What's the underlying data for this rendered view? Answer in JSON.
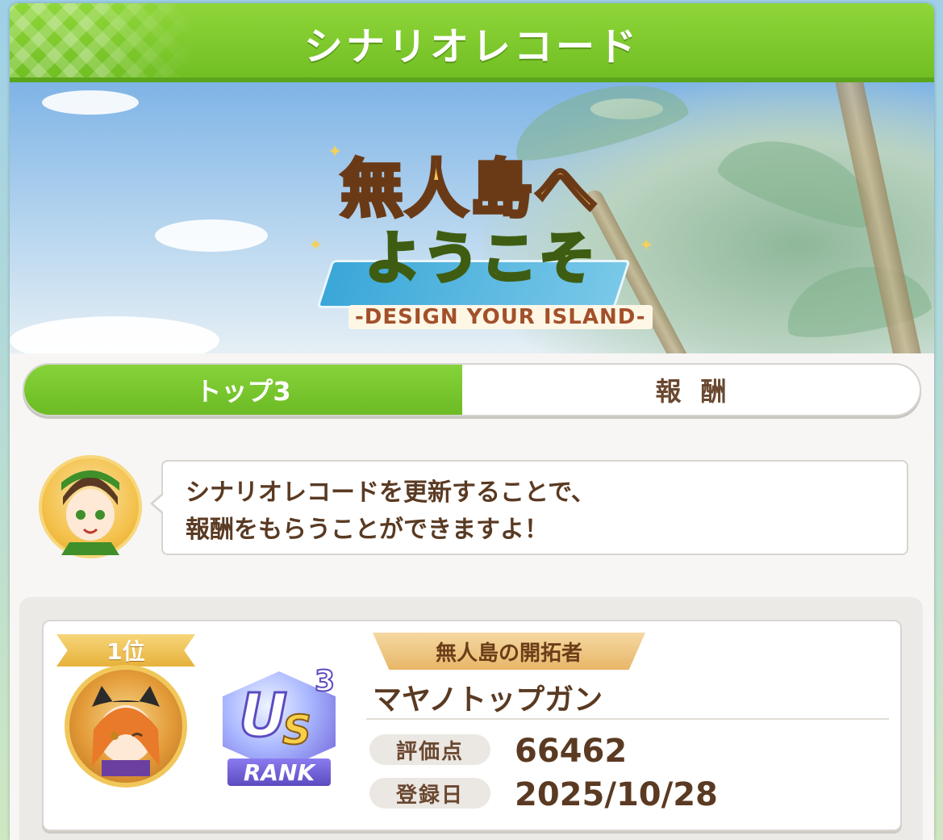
{
  "header": {
    "title": "シナリオレコード"
  },
  "banner": {
    "logo_line1": "無人島へ",
    "logo_line2": "ようこそ",
    "logo_subtitle": "-DESIGN YOUR ISLAND-"
  },
  "tabs": [
    {
      "label": "トップ3",
      "active": true
    },
    {
      "label": "報酬",
      "active": false
    }
  ],
  "dialog": {
    "line1": "シナリオレコードを更新することで、",
    "line2": "報酬をもらうことができますよ！"
  },
  "record": {
    "rank_label": "1位",
    "rank_badge": {
      "u": "U",
      "s": "S",
      "n": "3",
      "label": "RANK"
    },
    "title_badge": "無人島の開拓者",
    "trainer_name": "マヤノトップガン",
    "score_label": "評価点",
    "score_value": "66462",
    "date_label": "登録日",
    "date_value": "2025/10/28"
  },
  "colors": {
    "accent_green": "#6cbb24",
    "text_brown": "#5a3a22",
    "gold": "#e7b13b",
    "rank_purple": "#5b4bc0"
  }
}
